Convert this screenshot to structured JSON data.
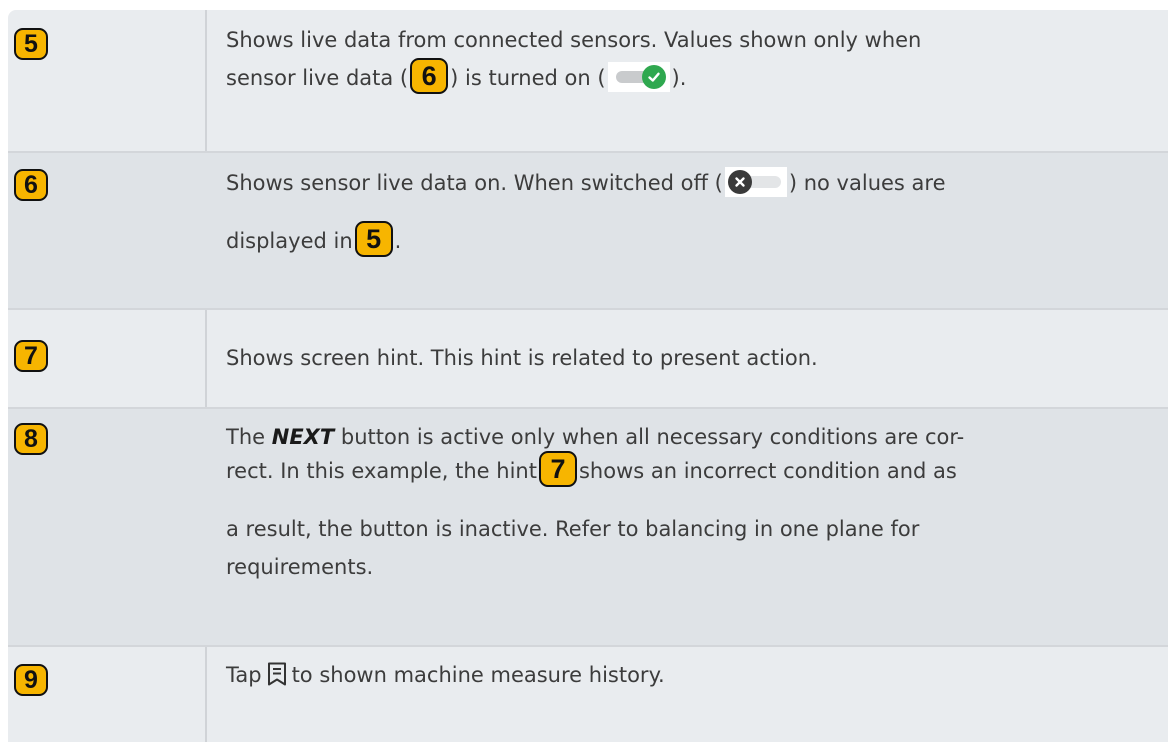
{
  "rows": [
    {
      "badge": "5",
      "line1": "Shows live data from connected sensors. Values shown only when",
      "line2_a": "sensor live data (",
      "line2_badge": "6",
      "line2_b": ") is turned on (",
      "line2_c": ")."
    },
    {
      "badge": "6",
      "line1_a": "Shows sensor live data on. When switched off (",
      "line1_b": ") no values are",
      "line2_a": "displayed in",
      "line2_badge": "5",
      "line2_b": "."
    },
    {
      "badge": "7",
      "text": "Shows screen hint. This hint is related to present action."
    },
    {
      "badge": "8",
      "line1_a": "The",
      "line1_bold": "NEXT",
      "line1_b": "button is active only when all necessary conditions are cor-",
      "line2_a": "rect. In this example, the hint",
      "line2_badge": "7",
      "line2_b": "shows an incorrect condition and as",
      "line3": "a result, the button is inactive. Refer to balancing in one plane for",
      "line4": "requirements."
    },
    {
      "badge": "9",
      "text_a": "Tap",
      "text_b": "to shown machine measure history."
    }
  ],
  "icons": {
    "toggle_on": "toggle-on-check-icon",
    "toggle_off": "toggle-off-x-icon",
    "history": "measure-history-icon"
  },
  "colors": {
    "badge": "#f7b500",
    "row_bg": "#e9ecef",
    "row_alt_bg": "#dfe3e7",
    "toggle_on": "#2fa84f"
  }
}
